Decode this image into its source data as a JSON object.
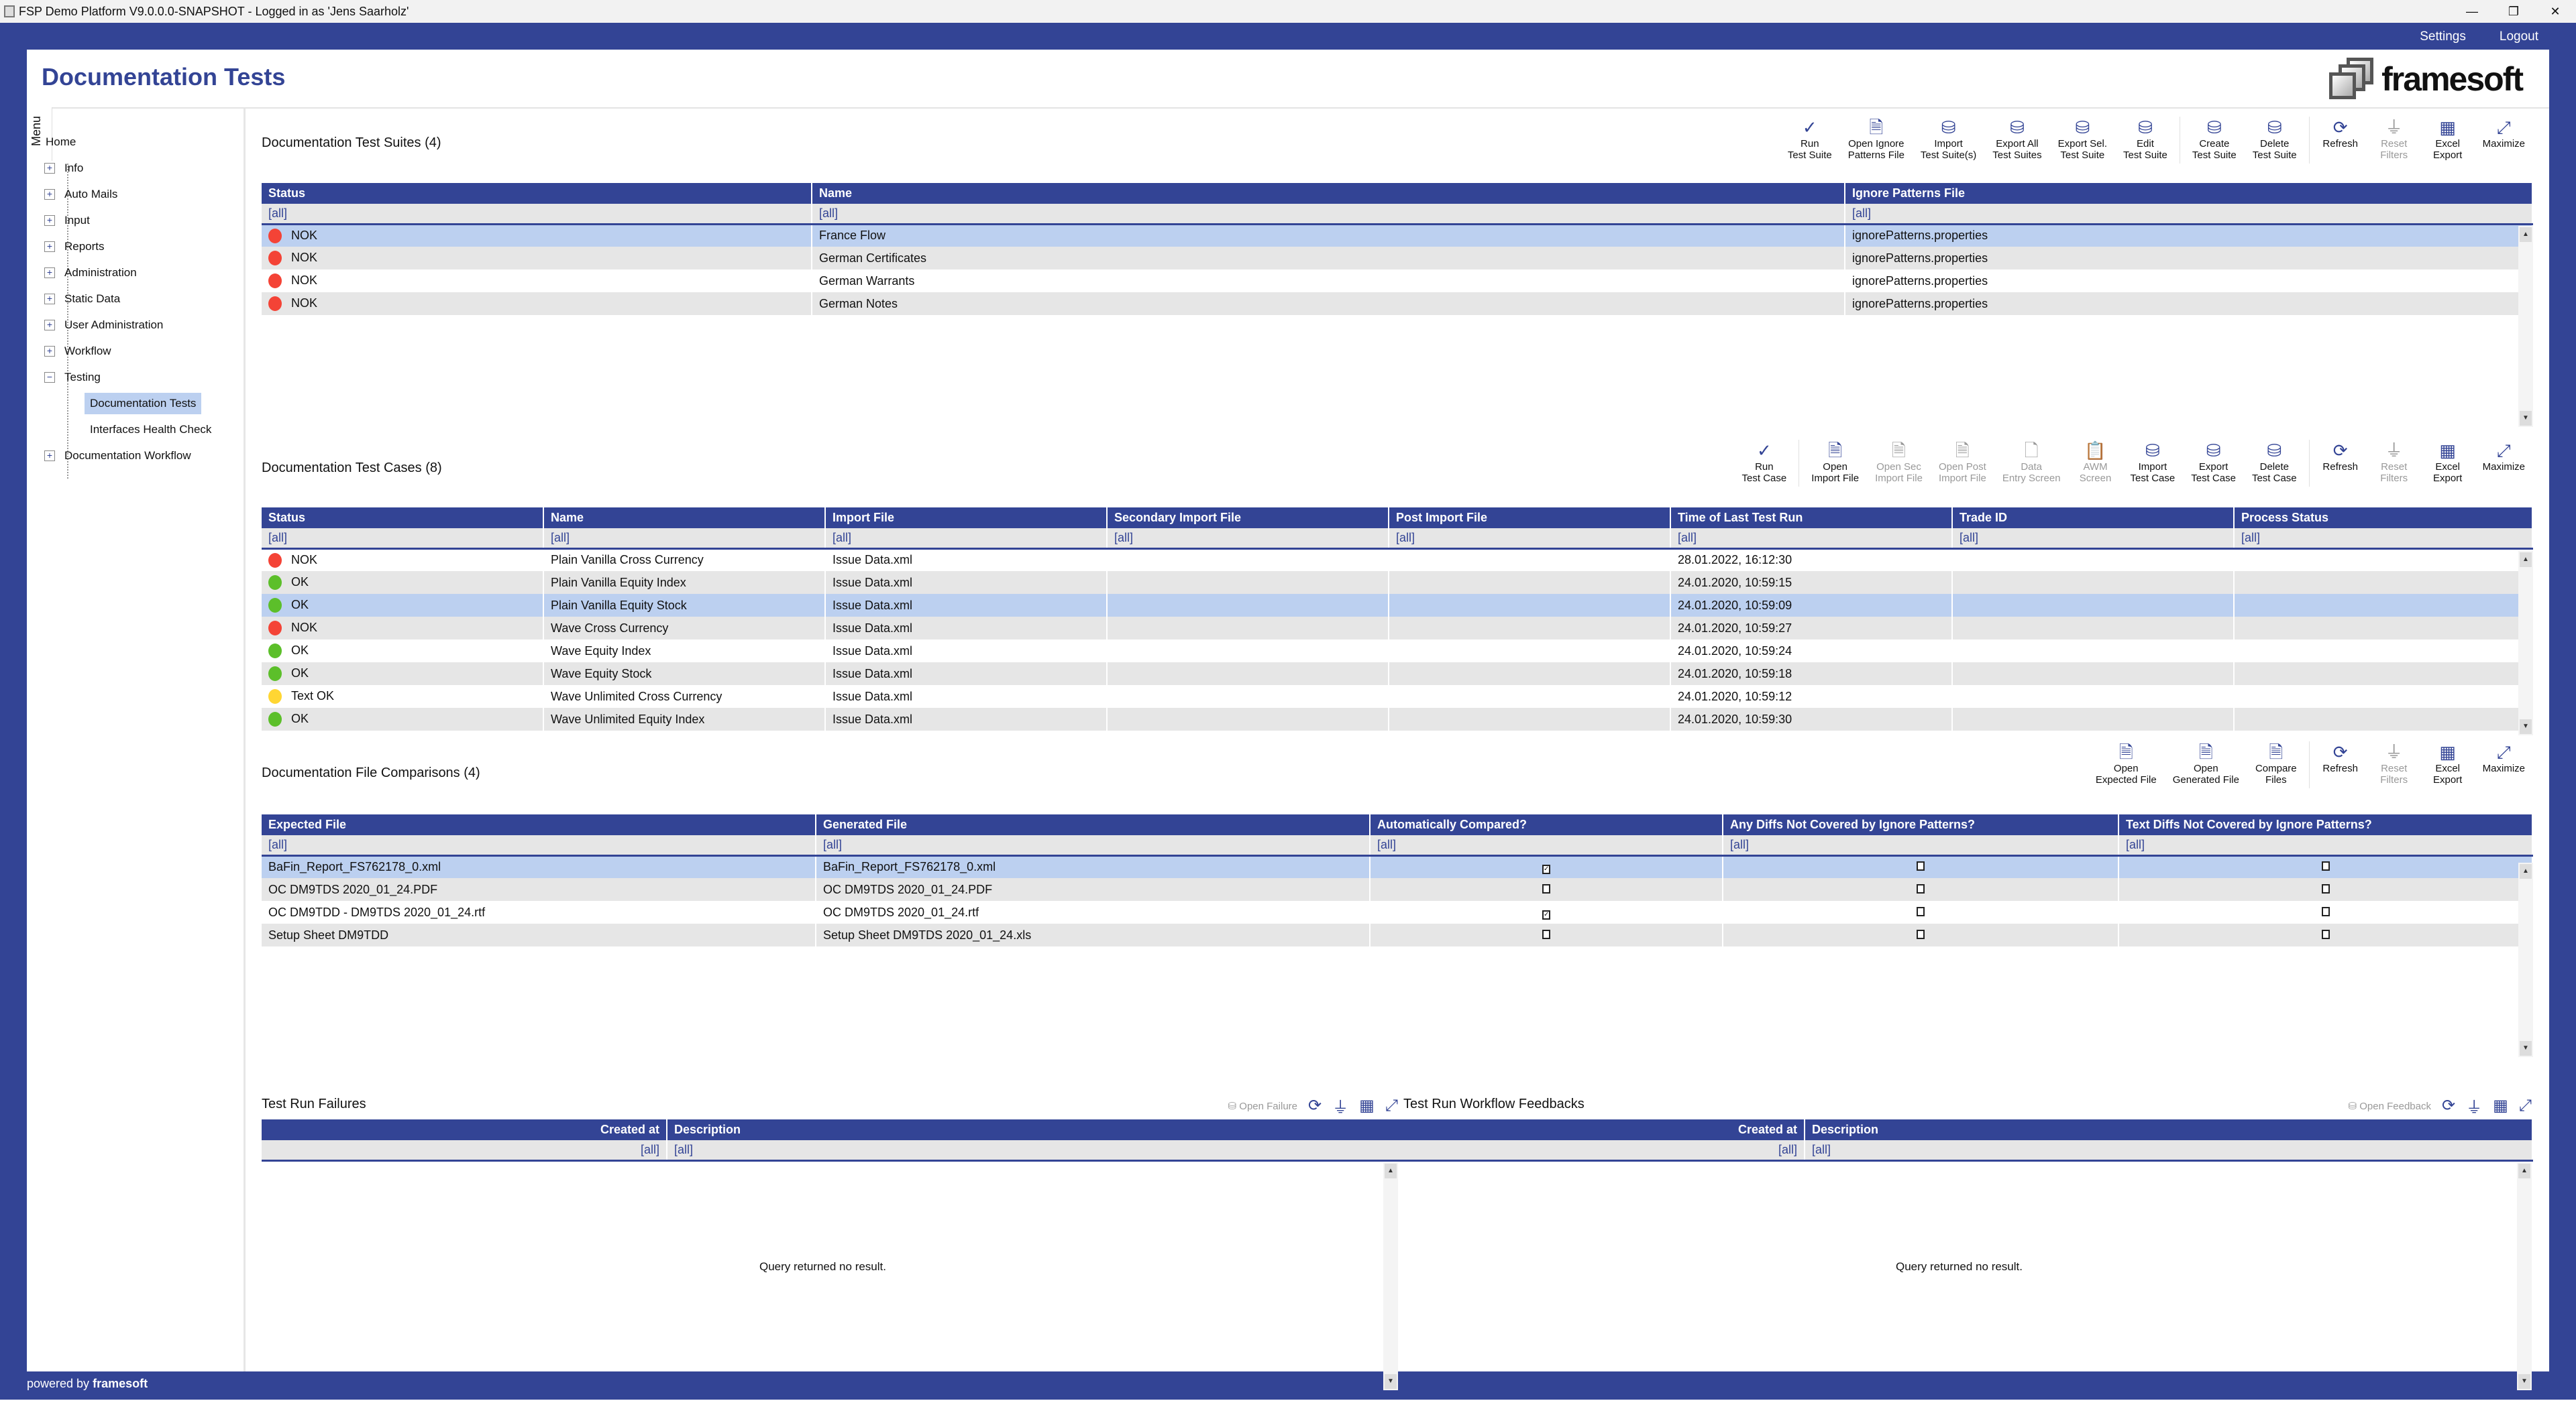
{
  "window": {
    "title": "FSP Demo Platform V9.0.0.0-SNAPSHOT - Logged in as 'Jens Saarholz'",
    "minimize": "—",
    "restore": "❐",
    "close": "✕"
  },
  "topnav": {
    "settings": "Settings",
    "logout": "Logout"
  },
  "page": {
    "title": "Documentation Tests",
    "logo_text": "framesoft",
    "menu_tab": "Menu"
  },
  "sidebar": {
    "home": "Home",
    "items": [
      {
        "label": "Info",
        "toggle": "+"
      },
      {
        "label": "Auto Mails",
        "toggle": "+"
      },
      {
        "label": "Input",
        "toggle": "+"
      },
      {
        "label": "Reports",
        "toggle": "+"
      },
      {
        "label": "Administration",
        "toggle": "+"
      },
      {
        "label": "Static Data",
        "toggle": "+"
      },
      {
        "label": "User Administration",
        "toggle": "+"
      },
      {
        "label": "Workflow",
        "toggle": "+"
      },
      {
        "label": "Testing",
        "toggle": "−"
      }
    ],
    "testing_children": [
      "Documentation Tests",
      "Interfaces Health Check"
    ],
    "last": {
      "label": "Documentation Workflow",
      "toggle": "+"
    }
  },
  "colors": {
    "brand": "#334495",
    "selected_row": "#bcd0f0",
    "nok": "#f44336",
    "ok": "#5cbf2a",
    "text_ok": "#ffd633"
  },
  "suites": {
    "title": "Documentation Test Suites  (4)",
    "toolbar": [
      {
        "icon": "✓",
        "name": "run-test-suite",
        "l1": "Run",
        "l2": "Test Suite"
      },
      {
        "icon": "🗎",
        "name": "open-ignore-patterns-file",
        "l1": "Open Ignore",
        "l2": "Patterns File"
      },
      {
        "icon": "⛁",
        "name": "import-test-suites",
        "l1": "Import",
        "l2": "Test Suite(s)"
      },
      {
        "icon": "⛁",
        "name": "export-all-test-suites",
        "l1": "Export All",
        "l2": "Test Suites"
      },
      {
        "icon": "⛁",
        "name": "export-sel-test-suite",
        "l1": "Export Sel.",
        "l2": "Test Suite"
      },
      {
        "icon": "⛁",
        "name": "edit-test-suite",
        "l1": "Edit",
        "l2": "Test Suite"
      },
      {
        "icon": "⛁",
        "name": "create-test-suite",
        "l1": "Create",
        "l2": "Test Suite"
      },
      {
        "icon": "⛁",
        "name": "delete-test-suite",
        "l1": "Delete",
        "l2": "Test Suite"
      },
      {
        "icon": "⟳",
        "name": "refresh",
        "l1": "Refresh",
        "l2": ""
      },
      {
        "icon": "⏚",
        "name": "reset-filters",
        "l1": "Reset",
        "l2": "Filters",
        "disabled": true
      },
      {
        "icon": "▦",
        "name": "excel-export",
        "l1": "Excel",
        "l2": "Export"
      },
      {
        "icon": "⤢",
        "name": "maximize",
        "l1": "Maximize",
        "l2": ""
      }
    ],
    "columns": [
      "Status",
      "Name",
      "Ignore Patterns File"
    ],
    "filter": "[all]",
    "rows": [
      {
        "status": "NOK",
        "color": "#f44336",
        "name": "France Flow",
        "file": "ignorePatterns.properties"
      },
      {
        "status": "NOK",
        "color": "#f44336",
        "name": "German Certificates",
        "file": "ignorePatterns.properties"
      },
      {
        "status": "NOK",
        "color": "#f44336",
        "name": "German  Warrants",
        "file": "ignorePatterns.properties"
      },
      {
        "status": "NOK",
        "color": "#f44336",
        "name": "German Notes",
        "file": "ignorePatterns.properties"
      }
    ]
  },
  "cases": {
    "title": "Documentation Test Cases  (8)",
    "toolbar": [
      {
        "icon": "✓",
        "name": "run-test-case",
        "l1": "Run",
        "l2": "Test Case"
      },
      {
        "icon": "🗎",
        "name": "open-import-file",
        "l1": "Open",
        "l2": "Import File"
      },
      {
        "icon": "🗎",
        "name": "open-sec-import-file",
        "l1": "Open Sec",
        "l2": "Import File",
        "disabled": true
      },
      {
        "icon": "🗎",
        "name": "open-post-import-file",
        "l1": "Open Post",
        "l2": "Import File",
        "disabled": true
      },
      {
        "icon": "🗋",
        "name": "data-entry-screen",
        "l1": "Data",
        "l2": "Entry Screen",
        "disabled": true
      },
      {
        "icon": "📋",
        "name": "awm-screen",
        "l1": "AWM",
        "l2": "Screen",
        "disabled": true
      },
      {
        "icon": "⛁",
        "name": "import-test-case",
        "l1": "Import",
        "l2": "Test Case"
      },
      {
        "icon": "⛁",
        "name": "export-test-case",
        "l1": "Export",
        "l2": "Test Case"
      },
      {
        "icon": "⛁",
        "name": "delete-test-case",
        "l1": "Delete",
        "l2": "Test Case"
      },
      {
        "icon": "⟳",
        "name": "refresh",
        "l1": "Refresh",
        "l2": ""
      },
      {
        "icon": "⏚",
        "name": "reset-filters",
        "l1": "Reset",
        "l2": "Filters",
        "disabled": true
      },
      {
        "icon": "▦",
        "name": "excel-export",
        "l1": "Excel",
        "l2": "Export"
      },
      {
        "icon": "⤢",
        "name": "maximize",
        "l1": "Maximize",
        "l2": ""
      }
    ],
    "columns": [
      "Status",
      "Name",
      "Import File",
      "Secondary Import File",
      "Post Import File",
      "Time of Last Test Run",
      "Trade ID",
      "Process Status"
    ],
    "filter": "[all]",
    "rows": [
      {
        "status": "NOK",
        "color": "#f44336",
        "name": "Plain Vanilla Cross Currency",
        "import": "Issue Data.xml",
        "time": "28.01.2022, 16:12:30"
      },
      {
        "status": "OK",
        "color": "#5cbf2a",
        "name": "Plain Vanilla Equity Index",
        "import": "Issue Data.xml",
        "time": "24.01.2020, 10:59:15"
      },
      {
        "status": "OK",
        "color": "#5cbf2a",
        "name": "Plain Vanilla Equity Stock",
        "import": "Issue Data.xml",
        "time": "24.01.2020, 10:59:09"
      },
      {
        "status": "NOK",
        "color": "#f44336",
        "name": "Wave Cross Currency",
        "import": "Issue Data.xml",
        "time": "24.01.2020, 10:59:27"
      },
      {
        "status": "OK",
        "color": "#5cbf2a",
        "name": "Wave Equity Index",
        "import": "Issue Data.xml",
        "time": "24.01.2020, 10:59:24"
      },
      {
        "status": "OK",
        "color": "#5cbf2a",
        "name": "Wave Equity Stock",
        "import": "Issue Data.xml",
        "time": "24.01.2020, 10:59:18"
      },
      {
        "status": "Text OK",
        "color": "#ffd633",
        "name": "Wave Unlimited Cross Currency",
        "import": "Issue Data.xml",
        "time": "24.01.2020, 10:59:12"
      },
      {
        "status": "OK",
        "color": "#5cbf2a",
        "name": "Wave Unlimited Equity Index",
        "import": "Issue Data.xml",
        "time": "24.01.2020, 10:59:30"
      }
    ]
  },
  "comparisons": {
    "title": "Documentation File Comparisons  (4)",
    "toolbar": [
      {
        "icon": "🗎",
        "name": "open-expected-file",
        "l1": "Open",
        "l2": "Expected File"
      },
      {
        "icon": "🗎",
        "name": "open-generated-file",
        "l1": "Open",
        "l2": "Generated File"
      },
      {
        "icon": "🗎",
        "name": "compare-files",
        "l1": "Compare",
        "l2": "Files"
      },
      {
        "icon": "⟳",
        "name": "refresh",
        "l1": "Refresh",
        "l2": ""
      },
      {
        "icon": "⏚",
        "name": "reset-filters",
        "l1": "Reset",
        "l2": "Filters",
        "disabled": true
      },
      {
        "icon": "▦",
        "name": "excel-export",
        "l1": "Excel",
        "l2": "Export"
      },
      {
        "icon": "⤢",
        "name": "maximize",
        "l1": "Maximize",
        "l2": ""
      }
    ],
    "columns": [
      "Expected File",
      "Generated File",
      "Automatically Compared?",
      "Any Diffs Not Covered by Ignore Patterns?",
      "Text Diffs Not Covered by Ignore Patterns?"
    ],
    "filter": "[all]",
    "rows": [
      {
        "expected": "BaFin_Report_FS762178_0.xml",
        "generated": "BaFin_Report_FS762178_0.xml",
        "auto": true,
        "any": false,
        "text": false
      },
      {
        "expected": "OC DM9TDS 2020_01_24.PDF",
        "generated": "OC DM9TDS 2020_01_24.PDF",
        "auto": false,
        "any": false,
        "text": false
      },
      {
        "expected": "OC DM9TDD - DM9TDS 2020_01_24.rtf",
        "generated": "OC DM9TDS 2020_01_24.rtf",
        "auto": true,
        "any": false,
        "text": false
      },
      {
        "expected": "Setup Sheet DM9TDD",
        "generated": "Setup Sheet DM9TDS 2020_01_24.xls",
        "auto": false,
        "any": false,
        "text": false
      }
    ]
  },
  "failures": {
    "title": "Test Run Failures",
    "open_label": "Open Failure",
    "columns": [
      "Created at",
      "Description"
    ],
    "filter": "[all]",
    "empty": "Query returned no result."
  },
  "feedbacks": {
    "title": "Test Run Workflow Feedbacks",
    "open_label": "Open Feedback",
    "columns": [
      "Created at",
      "Description"
    ],
    "filter": "[all]",
    "empty": "Query returned no result."
  },
  "footer": {
    "prefix": "powered by",
    "brand": "framesoft"
  }
}
